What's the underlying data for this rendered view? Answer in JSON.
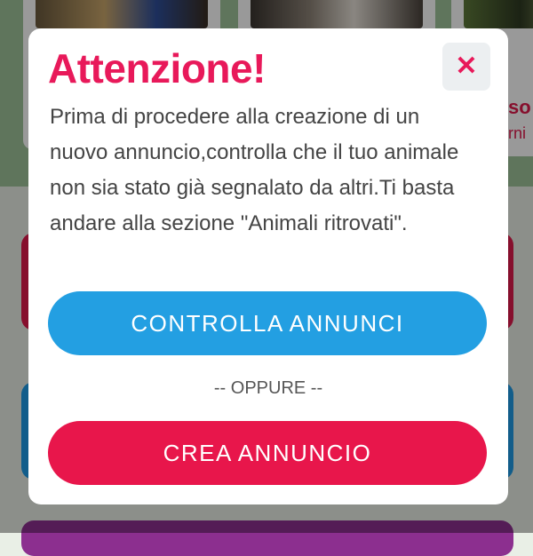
{
  "background": {
    "peek_title": "so",
    "peek_subtitle": "rni"
  },
  "modal": {
    "title": "Attenzione!",
    "close_icon": "close-icon",
    "message": "Prima di procedere alla creazione di un nuovo annuncio,controlla che il tuo animale non sia stato già segnalato da altri.Ti basta andare alla sezione \"Animali ritrovati\".",
    "primary_button_label": "CONTROLLA ANNUNCI",
    "divider_label": "-- OPPURE --",
    "secondary_button_label": "CREA ANNUNCIO"
  },
  "colors": {
    "accent_pink": "#e8195a",
    "primary_blue": "#239fe2",
    "secondary_red": "#e8164b"
  }
}
